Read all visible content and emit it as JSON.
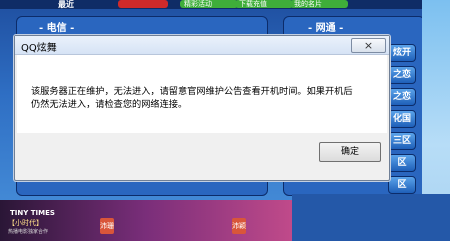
{
  "background": {
    "top_label": "最近",
    "top_buttons": [
      "",
      "精彩活动",
      "下载充值",
      "我的名片"
    ],
    "left_panel_title": "- 电信 -",
    "right_panel_title": "- 网通 -",
    "side_buttons": [
      "炫开",
      "之恋",
      "之恋",
      "化国",
      "三区",
      "区",
      "区"
    ],
    "banner": {
      "title": "TINY TIMES",
      "subtitle": "【小时代】",
      "sub2": "热播电影独家合作",
      "tags": [
        "沛珊",
        "沛颖"
      ]
    }
  },
  "dialog": {
    "title": "QQ炫舞",
    "close": "×",
    "message": "该服务器正在维护，无法进入，请留意官网维护公告查看开机时间。如果开机后仍然无法进入，请检查您的网络连接。",
    "ok_label": "确定"
  }
}
